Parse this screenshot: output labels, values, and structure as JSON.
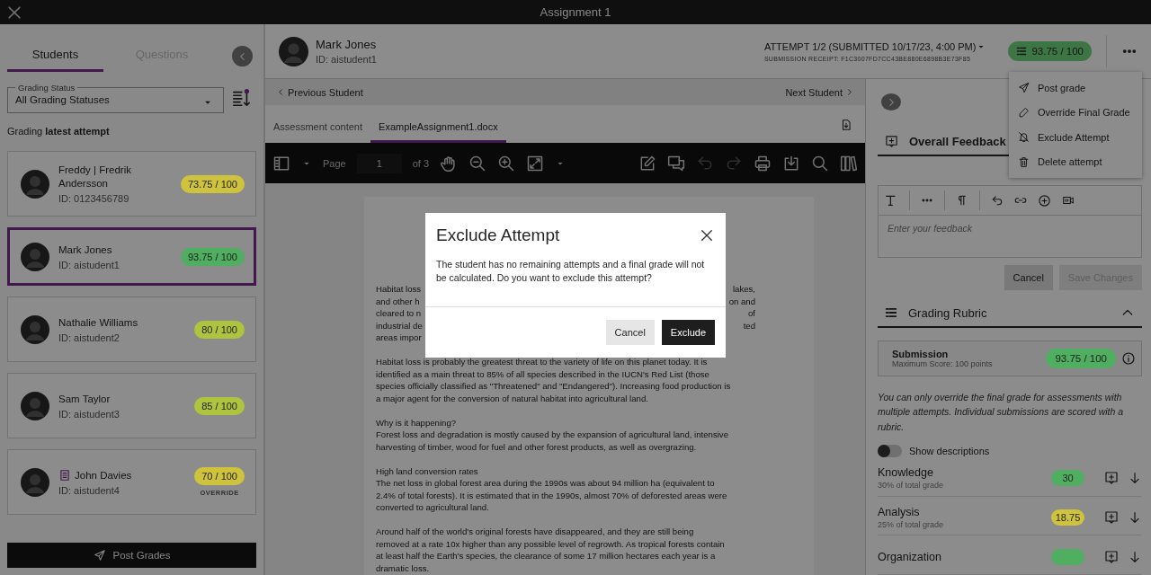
{
  "window": {
    "title": "Assignment 1"
  },
  "sidebar": {
    "tabs": [
      {
        "label": "Students",
        "selected": true
      },
      {
        "label": "Questions",
        "selected": false
      }
    ],
    "filter": {
      "label": "Grading Status",
      "value": "All Grading Statuses"
    },
    "grading_note": "Grading **latest attempt**",
    "students": [
      {
        "name": "Freddy | Fredrik Andersson",
        "id": "ID: 0123456789",
        "score": "73.75 / 100",
        "color": "#cfc23c",
        "selected": false,
        "document_icon": false
      },
      {
        "name": "Mark Jones",
        "id": "ID: aistudent1",
        "score": "93.75 / 100",
        "color": "#4fae60",
        "selected": true,
        "document_icon": false
      },
      {
        "name": "Nathalie Williams",
        "id": "ID: aistudent2",
        "score": "80 / 100",
        "color": "#aec43e",
        "selected": false,
        "document_icon": false
      },
      {
        "name": "Sam Taylor",
        "id": "ID: aistudent3",
        "score": "85 / 100",
        "color": "#aec43e",
        "selected": false,
        "document_icon": false
      },
      {
        "name": "John Davies",
        "id": "ID: aistudent4",
        "score": "70 / 100",
        "color": "#cfc23c",
        "selected": false,
        "document_icon": true,
        "note": "OVERRIDE"
      }
    ],
    "post_button": "Post Grades"
  },
  "header": {
    "student": {
      "name": "Mark Jones",
      "id": "ID: aistudent1"
    },
    "attempt": "ATTEMPT 1/2 (SUBMITTED 10/17/23, 4:00 PM)",
    "receipt": "SUBMISSION RECEIPT: F1C3007FD7CC43BE880E6898B3E73F85",
    "score": "93.75 / 100"
  },
  "menu": [
    {
      "label": "Post grade"
    },
    {
      "label": "Override Final Grade"
    },
    {
      "label": "Exclude Attempt"
    },
    {
      "label": "Delete attempt"
    }
  ],
  "navigation": {
    "previous": "Previous Student",
    "next": "Next Student"
  },
  "document_tabs": [
    {
      "label": "Assessment content",
      "selected": false
    },
    {
      "label": "ExampleAssignment1.docx",
      "selected": true
    }
  ],
  "viewer_toolbar": {
    "page_label": "Page",
    "page": "1",
    "page_count": "of 3"
  },
  "document": {
    "covered_lines": [
      {
        "left": "Habitat loss",
        "right": "lakes,"
      },
      {
        "left": "and other h",
        "right": "on and"
      },
      {
        "left": "cleared to n",
        "right": "of"
      },
      {
        "left": "industrial de",
        "right": "ted"
      },
      {
        "left": "areas impor"
      }
    ],
    "paragraphs": [
      [
        "Habitat loss is probably the greatest threat to the variety of life on this planet today. It is",
        "identified as a main threat to 85% of all species described in the IUCN's Red List (those",
        "species officially classified as \"Threatened\" and \"Endangered\"). Increasing food production is",
        "a major agent for the conversion of natural habitat into agricultural land."
      ],
      [
        "Why is it happening?",
        "Forest loss and degradation is mostly caused by the expansion of agricultural land, intensive",
        "harvesting of timber, wood for fuel and other forest products, as well as overgrazing."
      ],
      [
        "High land conversion rates",
        "The net loss in global forest area during the 1990s was about 94 million ha (equivalent to",
        "2.4% of total forests). It is estimated that in the 1990s, almost 70% of deforested areas were",
        "converted to agricultural land."
      ],
      [
        "Around half of the world's original forests have disappeared, and they are still being",
        "removed at a rate 10x higher than any possible level of regrowth. As tropical forests contain",
        "at least half the Earth's species, the clearance of some 17 million hectares each year is a",
        "dramatic loss."
      ]
    ]
  },
  "feedback": {
    "title": "Overall Feedback",
    "placeholder": "Enter your feedback",
    "cancel": "Cancel",
    "save": "Save Changes",
    "save_disabled": true
  },
  "rubric": {
    "title": "Grading Rubric",
    "expanded": true,
    "submission": {
      "title": "Submission",
      "subtitle": "Maximum Score: 100 points",
      "score": "93.75 / 100"
    },
    "note": "You can only override the final grade for assessments with multiple attempts. Individual submissions are scored with a rubric.",
    "toggle": {
      "label": "Show descriptions",
      "on": false
    },
    "criteria": [
      {
        "name": "Knowledge",
        "weight": "30% of total grade",
        "score": "30",
        "color": "#4fae60"
      },
      {
        "name": "Analysis",
        "weight": "25% of total grade",
        "score": "18.75",
        "color": "#cfc23c"
      },
      {
        "name": "Organization",
        "color": "#4fae60"
      }
    ]
  },
  "modal": {
    "title": "Exclude Attempt",
    "message": "The student has no remaining attempts and a final grade will not be calculated. Do you want to exclude this attempt?",
    "buttons": [
      {
        "label": "Cancel",
        "kind": "secondary"
      },
      {
        "label": "Exclude",
        "kind": "primary"
      }
    ]
  }
}
